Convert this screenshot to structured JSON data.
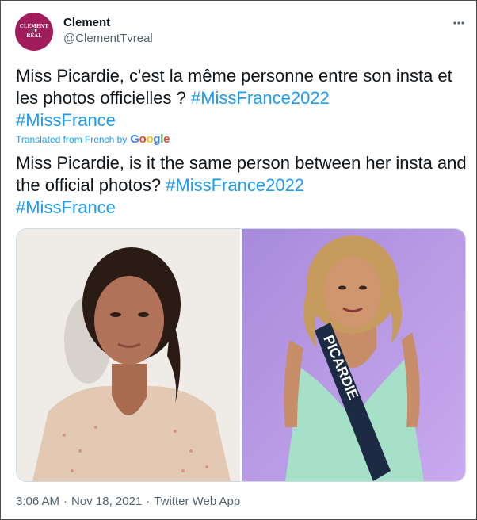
{
  "author": {
    "display_name": "Clement",
    "handle": "@ClementTvreal",
    "avatar_lines": [
      "CLÉMENT",
      "TV",
      "RÉAL"
    ]
  },
  "more_icon": "more-horizontal-icon",
  "tweet": {
    "original": {
      "text": "Miss Picardie, c'est la même personne entre son insta et les photos officielles ? ",
      "hashtag1": "#MissFrance2022",
      "hashtag2": "#MissFrance"
    },
    "translation_note": "Translated from French by",
    "translation_provider": "Google",
    "translated": {
      "text": "Miss Picardie, is it the same person between her insta and the official photos? ",
      "hashtag1": "#MissFrance2022",
      "hashtag2": "#MissFrance"
    }
  },
  "media": {
    "sash_text": "PICARDIE"
  },
  "footer": {
    "time": "3:06 AM",
    "separator": "·",
    "date": "Nov 18, 2021",
    "source": "Twitter Web App"
  },
  "colors": {
    "link": "#1d9bf0",
    "secondary_text": "#536471",
    "avatar_bg": "#a01c5a",
    "google_blue": "#4285f4",
    "google_red": "#ea4335",
    "google_yellow": "#fbbc05",
    "google_green": "#34a853"
  }
}
